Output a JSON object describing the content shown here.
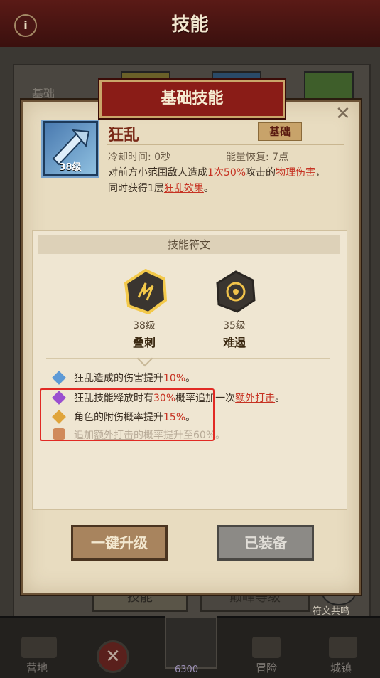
{
  "header": {
    "title": "技能"
  },
  "background": {
    "tab_base": "基础",
    "tab_skill": "技能",
    "tab_peak": "巅峰等级",
    "rune_resonance": "符文共鸣"
  },
  "bottom_nav": {
    "camp": "营地",
    "adventure": "冒险",
    "town": "城镇",
    "currency": "6300"
  },
  "modal": {
    "title": "基础技能",
    "skill": {
      "name": "狂乱",
      "level": "38级",
      "type": "基础",
      "cooldown": "冷却时间: 0秒",
      "energy": "能量恢复: 7点",
      "desc_1": "对前方小范围敌人造成",
      "desc_2": "1次",
      "desc_3": "50%",
      "desc_4": "攻击的",
      "desc_5": "物理伤害",
      "desc_6": "，同时获得1层",
      "desc_7": "狂乱效果",
      "desc_8": "。"
    },
    "runes": {
      "heading": "技能符文",
      "rune1": {
        "level": "38级",
        "name": "叠刺"
      },
      "rune2": {
        "level": "35级",
        "name": "难遏"
      }
    },
    "effects": [
      {
        "a": "狂乱造成的伤害提升",
        "b": "10%",
        "c": "。",
        "d": "",
        "e": ""
      },
      {
        "a": "狂乱技能释放时有",
        "b": "30%",
        "c": "概率追加一次",
        "d": "额外打击",
        "e": "。"
      },
      {
        "a": "角色的附伤概率提升",
        "b": "15%",
        "c": "。",
        "d": "",
        "e": ""
      },
      {
        "a": "追加",
        "b": "额外打击",
        "c": "的概率提升至",
        "d": "60%",
        "e": "。"
      }
    ],
    "buttons": {
      "upgrade": "一键升级",
      "equipped": "已装备"
    }
  }
}
